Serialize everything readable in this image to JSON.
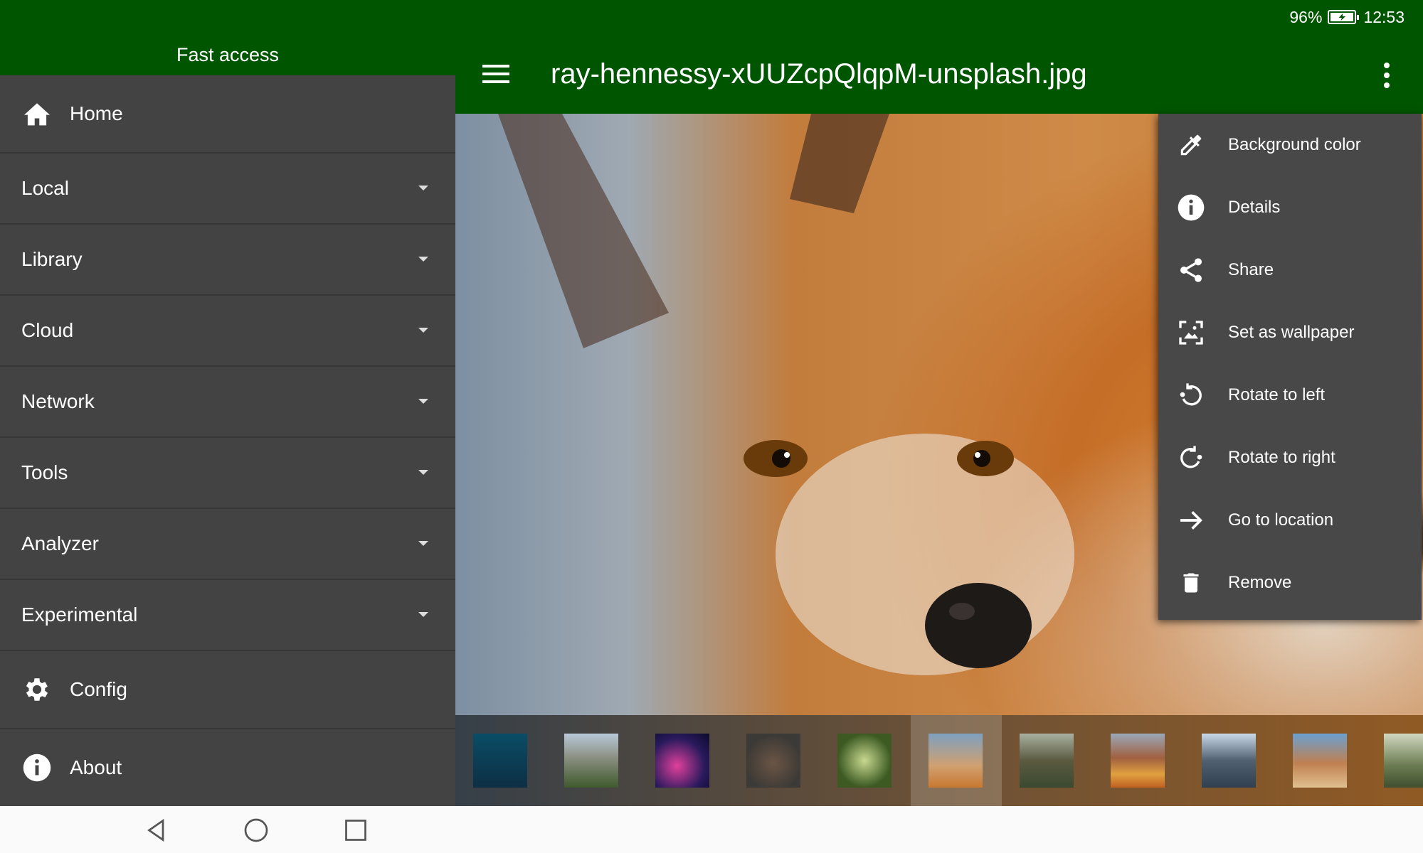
{
  "status_bar": {
    "battery": "96%",
    "time": "12:53"
  },
  "drawer": {
    "header": "Fast access",
    "items": [
      {
        "label": "Home",
        "icon": "home-icon"
      },
      {
        "label": "Local"
      },
      {
        "label": "Library"
      },
      {
        "label": "Cloud"
      },
      {
        "label": "Network"
      },
      {
        "label": "Tools"
      },
      {
        "label": "Analyzer"
      },
      {
        "label": "Experimental"
      },
      {
        "label": "Config",
        "icon": "gear-icon"
      },
      {
        "label": "About",
        "icon": "info-icon"
      }
    ]
  },
  "toolbar": {
    "title": "ray-hennessy-xUUZcpQlqpM-unsplash.jpg"
  },
  "menu": {
    "items": [
      {
        "label": "Background color",
        "icon": "eyedropper-icon"
      },
      {
        "label": "Details",
        "icon": "info-icon"
      },
      {
        "label": "Share",
        "icon": "share-icon"
      },
      {
        "label": "Set as wallpaper",
        "icon": "wallpaper-icon"
      },
      {
        "label": "Rotate to left",
        "icon": "rotate-left-icon"
      },
      {
        "label": "Rotate to right",
        "icon": "rotate-right-icon"
      },
      {
        "label": "Go to location",
        "icon": "arrow-right-icon"
      },
      {
        "label": "Remove",
        "icon": "trash-icon"
      }
    ]
  },
  "filmstrip": {
    "selected_index": 5,
    "thumbnails": [
      "sea-lion",
      "mountain-waterfall",
      "city-lights",
      "bear",
      "forest",
      "fox",
      "canyon",
      "beach-hills",
      "kirkjufell",
      "sea-arch",
      "waterfall"
    ]
  },
  "colors": {
    "app_bar": "#005500",
    "drawer_bg": "#434343",
    "menu_bg": "#484848"
  }
}
